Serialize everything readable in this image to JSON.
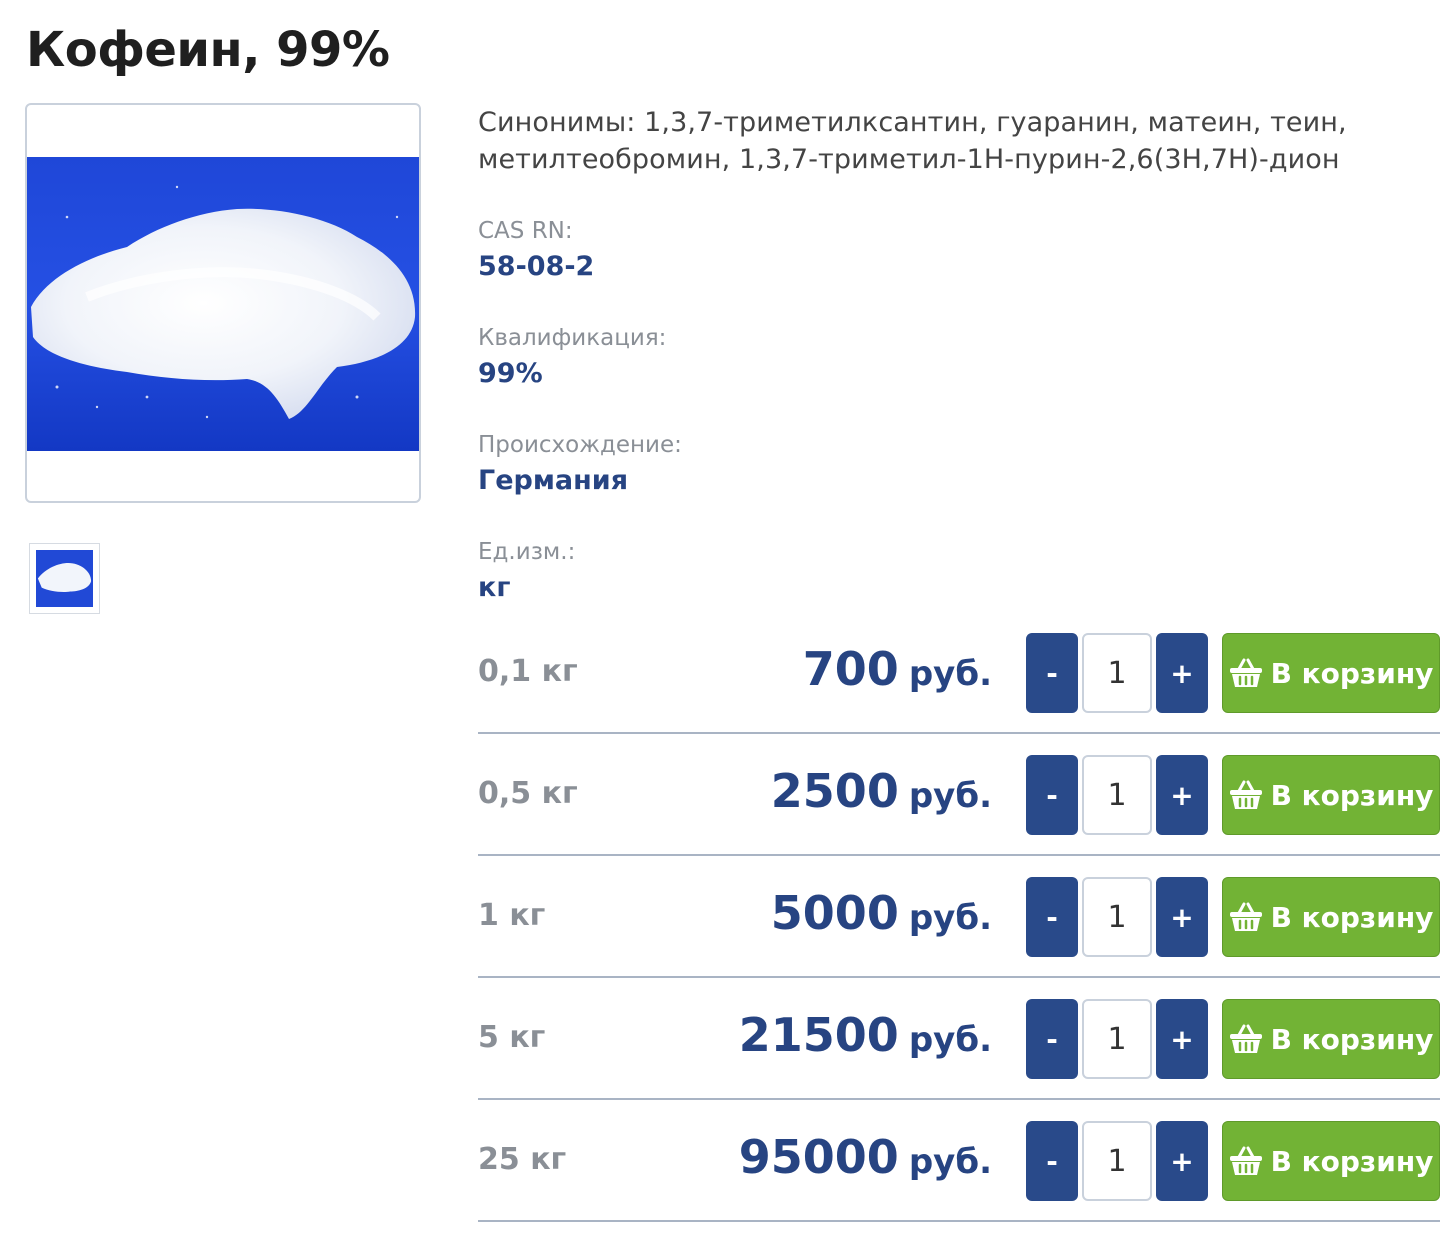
{
  "product": {
    "title": "Кофеин, 99%",
    "synonyms": "Синонимы: 1,3,7-триметилксантин, гуаранин, матеин, теин, метилтеобромин, 1,3,7-триметил-1Н-пурин-2,6(3Н,7Н)-дион",
    "properties": [
      {
        "label": "CAS RN:",
        "value": "58-08-2"
      },
      {
        "label": "Квалификация:",
        "value": "99%"
      },
      {
        "label": "Происхождение:",
        "value": "Германия"
      },
      {
        "label": "Ед.изм.:",
        "value": "кг"
      }
    ]
  },
  "colors": {
    "accent_blue": "#274482",
    "button_blue": "#294a8a",
    "cart_green": "#72b335",
    "muted_gray": "#8a8f96"
  },
  "icons": {
    "cart": "basket-icon",
    "thumbnail": "product-thumbnail"
  },
  "price_rows": [
    {
      "weight": "0,1 кг",
      "amount": "700",
      "currency": "руб.",
      "qty": "1",
      "minus": "-",
      "plus": "+",
      "cart_label": "В корзину"
    },
    {
      "weight": "0,5 кг",
      "amount": "2500",
      "currency": "руб.",
      "qty": "1",
      "minus": "-",
      "plus": "+",
      "cart_label": "В корзину"
    },
    {
      "weight": "1 кг",
      "amount": "5000",
      "currency": "руб.",
      "qty": "1",
      "minus": "-",
      "plus": "+",
      "cart_label": "В корзину"
    },
    {
      "weight": "5 кг",
      "amount": "21500",
      "currency": "руб.",
      "qty": "1",
      "minus": "-",
      "plus": "+",
      "cart_label": "В корзину"
    },
    {
      "weight": "25 кг",
      "amount": "95000",
      "currency": "руб.",
      "qty": "1",
      "minus": "-",
      "plus": "+",
      "cart_label": "В корзину"
    }
  ]
}
